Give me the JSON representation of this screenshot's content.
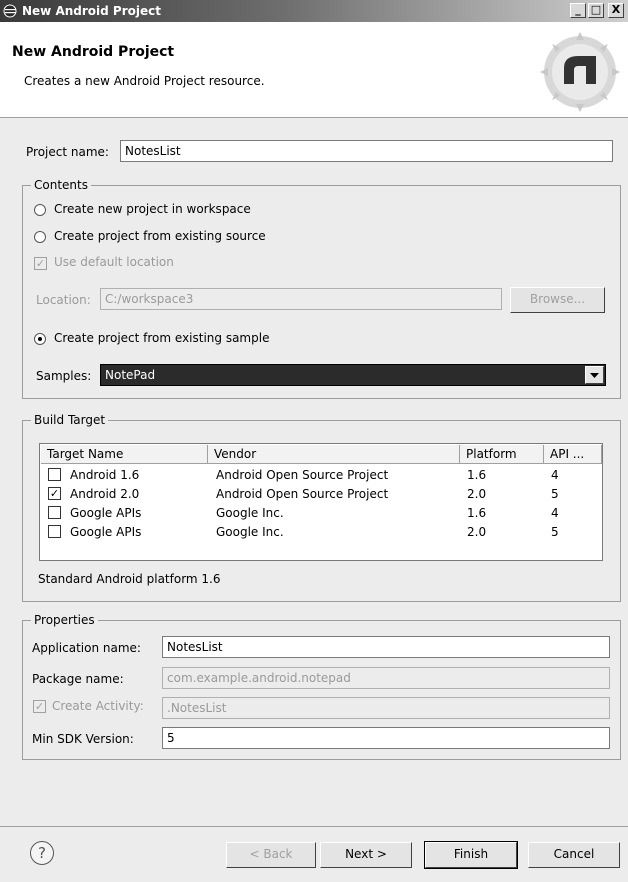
{
  "window": {
    "title": "New Android Project",
    "controls": {
      "minimize": "_",
      "maximize": "□",
      "close": "X"
    }
  },
  "header": {
    "title": "New Android Project",
    "description": "Creates a new Android Project resource."
  },
  "project_name": {
    "label": "Project name:",
    "value": "NotesList"
  },
  "contents": {
    "legend": "Contents",
    "radio_new": "Create new project in workspace",
    "radio_existing_source": "Create project from existing source",
    "use_default_location": "Use default location",
    "location_label": "Location:",
    "location_value": "C:/workspace3",
    "browse_label": "Browse...",
    "radio_sample": "Create project from existing sample",
    "samples_label": "Samples:",
    "samples_value": "NotePad"
  },
  "build_target": {
    "legend": "Build Target",
    "columns": [
      "Target Name",
      "Vendor",
      "Platform",
      "API ..."
    ],
    "rows": [
      {
        "name": "Android 1.6",
        "vendor": "Android Open Source Project",
        "platform": "1.6",
        "api": "4",
        "checked": false
      },
      {
        "name": "Android 2.0",
        "vendor": "Android Open Source Project",
        "platform": "2.0",
        "api": "5",
        "checked": true
      },
      {
        "name": "Google APIs",
        "vendor": "Google Inc.",
        "platform": "1.6",
        "api": "4",
        "checked": false
      },
      {
        "name": "Google APIs",
        "vendor": "Google Inc.",
        "platform": "2.0",
        "api": "5",
        "checked": false
      }
    ],
    "status_text": "Standard Android platform 1.6"
  },
  "properties": {
    "legend": "Properties",
    "app_name_label": "Application name:",
    "app_name_value": "NotesList",
    "package_label": "Package name:",
    "package_value": "com.example.android.notepad",
    "create_activity_label": "Create Activity:",
    "create_activity_value": ".NotesList",
    "min_sdk_label": "Min SDK Version:",
    "min_sdk_value": "5"
  },
  "footer": {
    "help_icon": "question-mark-icon",
    "back_label": "< Back",
    "next_label": "Next >",
    "finish_label": "Finish",
    "cancel_label": "Cancel"
  },
  "colors": {
    "selection": "#2b2b2b",
    "background": "#ececec"
  }
}
